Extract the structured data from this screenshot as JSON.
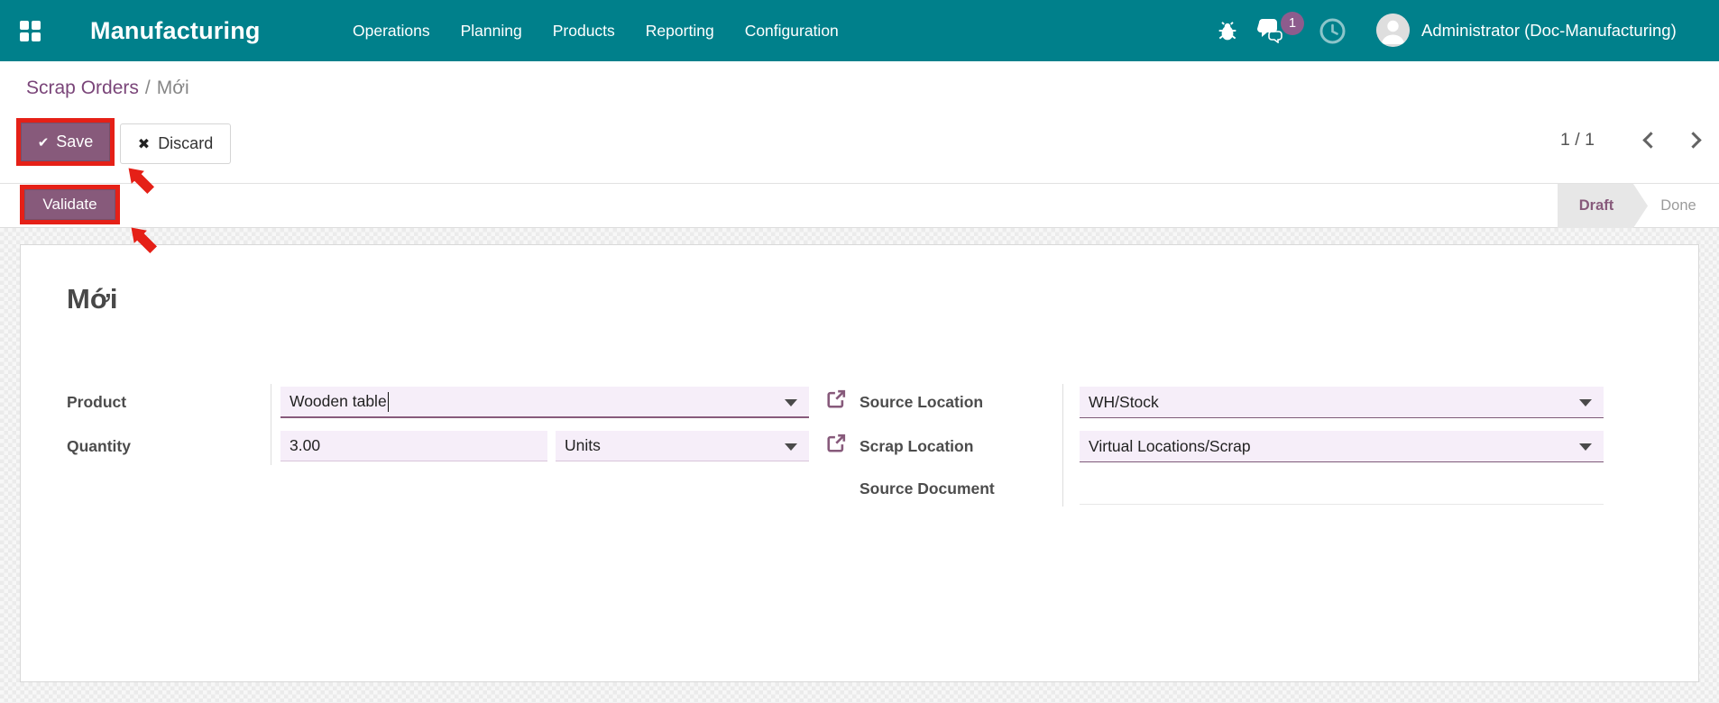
{
  "navbar": {
    "brand": "Manufacturing",
    "menus": [
      "Operations",
      "Planning",
      "Products",
      "Reporting",
      "Configuration"
    ],
    "message_badge": "1",
    "user": "Administrator (Doc-Manufacturing)"
  },
  "breadcrumb": {
    "parent": "Scrap Orders",
    "separator": "/",
    "current": "Mới"
  },
  "toolbar": {
    "save_label": "Save",
    "discard_label": "Discard",
    "pager": "1 / 1"
  },
  "statusbar": {
    "validate_label": "Validate",
    "states": [
      {
        "label": "Draft",
        "active": true
      },
      {
        "label": "Done",
        "active": false
      }
    ]
  },
  "form": {
    "title": "Mới",
    "fields": {
      "product": {
        "label": "Product",
        "value": "Wooden table"
      },
      "quantity": {
        "label": "Quantity",
        "value": "3.00",
        "uom": "Units"
      },
      "source_location": {
        "label": "Source Location",
        "value": "WH/Stock"
      },
      "scrap_location": {
        "label": "Scrap Location",
        "value": "Virtual Locations/Scrap"
      },
      "source_document": {
        "label": "Source Document",
        "value": ""
      }
    }
  },
  "icons": {
    "check": "✔",
    "cross": "✖"
  },
  "colors": {
    "navbar_teal": "#00808b",
    "accent_purple": "#875a7b",
    "annotation_red": "#e52017",
    "field_lavender": "#f6eef9"
  }
}
